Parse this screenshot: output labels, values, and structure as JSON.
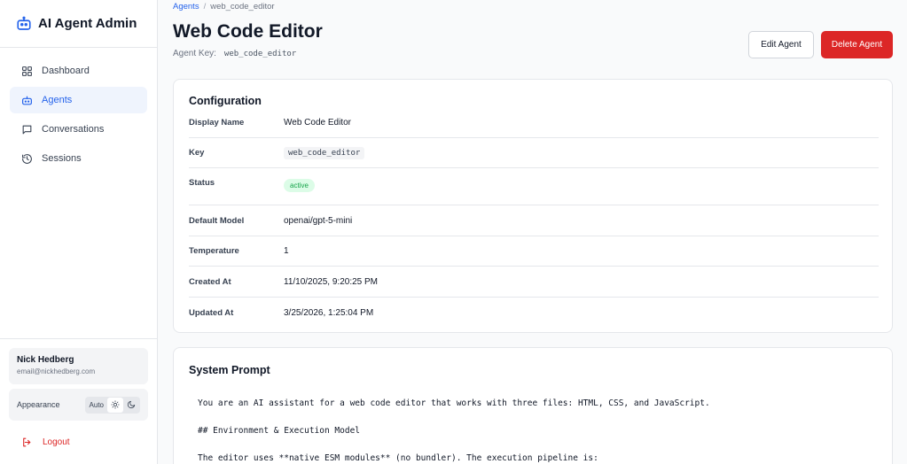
{
  "brand": {
    "title": "AI Agent Admin"
  },
  "sidebar": {
    "items": [
      {
        "label": "Dashboard",
        "icon": "grid-icon",
        "active": false
      },
      {
        "label": "Agents",
        "icon": "robot-icon",
        "active": true
      },
      {
        "label": "Conversations",
        "icon": "chat-icon",
        "active": false
      },
      {
        "label": "Sessions",
        "icon": "history-icon",
        "active": false
      }
    ],
    "user": {
      "name": "Nick Hedberg",
      "email": "email@nickhedberg.com"
    },
    "appearance": {
      "label": "Appearance",
      "auto": "Auto",
      "selected": "light"
    },
    "logout": "Logout"
  },
  "breadcrumb": {
    "root": "Agents",
    "separator": "/",
    "current": "web_code_editor"
  },
  "page": {
    "title": "Web Code Editor",
    "key_label": "Agent Key:",
    "key_value": "web_code_editor",
    "edit_label": "Edit Agent",
    "delete_label": "Delete Agent"
  },
  "config": {
    "title": "Configuration",
    "rows": [
      {
        "label": "Display Name",
        "value": "Web Code Editor"
      },
      {
        "label": "Key",
        "value": "web_code_editor"
      },
      {
        "label": "Status",
        "value": "active"
      },
      {
        "label": "Default Model",
        "value": "openai/gpt-5-mini"
      },
      {
        "label": "Temperature",
        "value": "1"
      },
      {
        "label": "Created At",
        "value": "11/10/2025, 9:20:25 PM"
      },
      {
        "label": "Updated At",
        "value": "3/25/2026, 1:25:04 PM"
      }
    ]
  },
  "prompt": {
    "title": "System Prompt",
    "lines": [
      "You are an AI assistant for a web code editor that works with three files: HTML, CSS, and JavaScript.",
      "## Environment & Execution Model",
      "The editor uses **native ESM modules** (no bundler). The execution pipeline is:"
    ]
  },
  "colors": {
    "accent": "#2563eb",
    "danger": "#dc2626",
    "success": "#16a34a"
  }
}
